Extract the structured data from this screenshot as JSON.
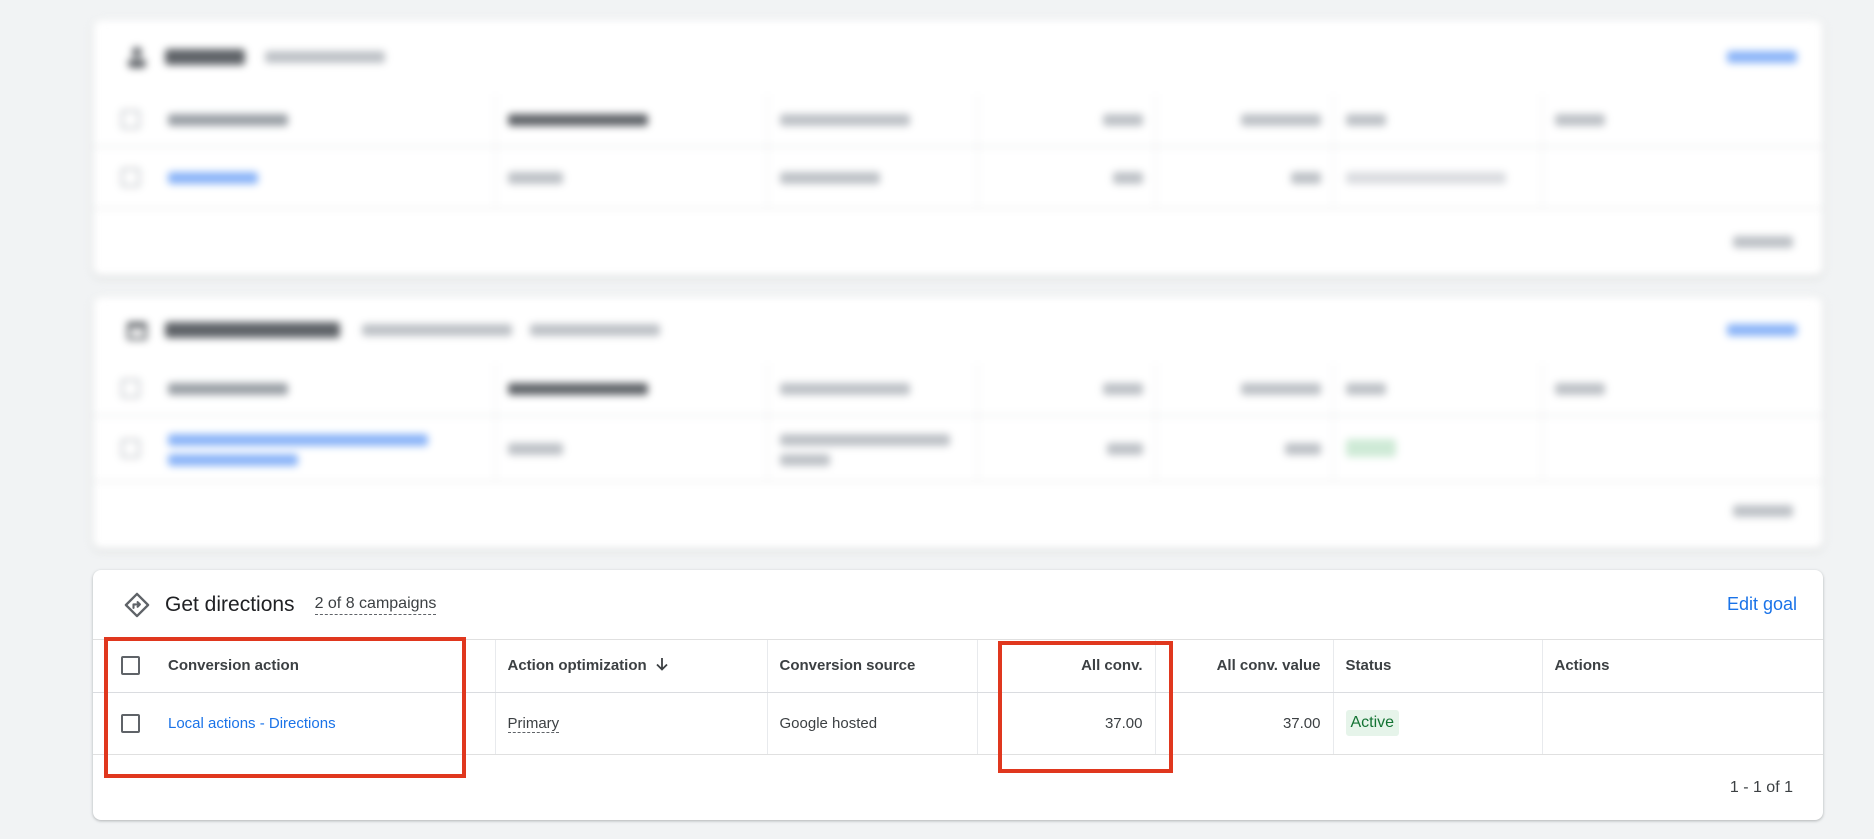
{
  "card3": {
    "title": "Get directions",
    "campaigns": "2 of 8 campaigns",
    "edit_goal": "Edit goal",
    "columns": {
      "conversion_action": "Conversion action",
      "action_optimization": "Action optimization",
      "conversion_source": "Conversion source",
      "all_conv": "All conv.",
      "all_conv_value": "All conv. value",
      "status": "Status",
      "actions": "Actions"
    },
    "row": {
      "conversion_action": "Local actions - Directions",
      "action_optimization": "Primary",
      "conversion_source": "Google hosted",
      "all_conv": "37.00",
      "all_conv_value": "37.00",
      "status": "Active"
    },
    "pagination": "1 - 1 of 1"
  },
  "colors": {
    "accent": "#1a73e8",
    "highlight": "#e0371e",
    "status_active_bg": "#e6f4ea",
    "status_active_text": "#137333"
  }
}
